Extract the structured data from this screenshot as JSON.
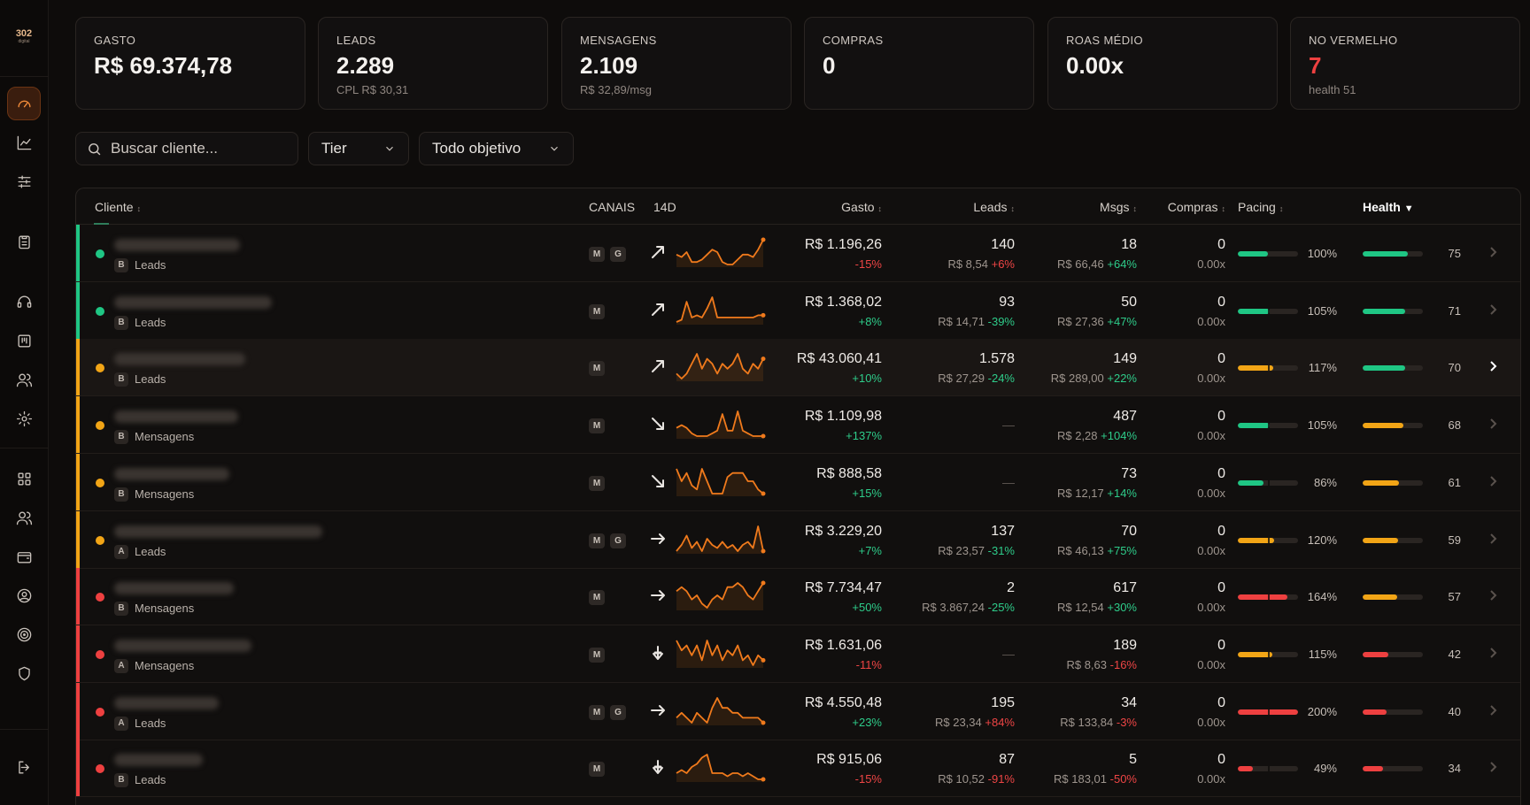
{
  "logo": {
    "text": "302",
    "sub": "digital"
  },
  "cards": [
    {
      "label": "GASTO",
      "value": "R$ 69.374,78",
      "sub": ""
    },
    {
      "label": "LEADS",
      "value": "2.289",
      "sub": "CPL R$ 30,31"
    },
    {
      "label": "MENSAGENS",
      "value": "2.109",
      "sub": "R$ 32,89/msg"
    },
    {
      "label": "COMPRAS",
      "value": "0",
      "sub": ""
    },
    {
      "label": "ROAS MÉDIO",
      "value": "0.00x",
      "sub": ""
    },
    {
      "label": "NO VERMELHO",
      "value": "7",
      "sub": "health 51"
    }
  ],
  "filters": {
    "search_placeholder": "Buscar cliente...",
    "tier": "Tier",
    "objective": "Todo objetivo"
  },
  "headers": {
    "cliente": "Cliente",
    "canais": "CANAIS",
    "d14": "14D",
    "gasto": "Gasto",
    "leads": "Leads",
    "msgs": "Msgs",
    "compras": "Compras",
    "pacing": "Pacing",
    "health": "Health"
  },
  "colors": {
    "green": "#1fc684",
    "yellow": "#f2a516",
    "red": "#ee4040",
    "spark": "#f07a1c"
  },
  "rows": [
    {
      "status": "green",
      "tier": "B",
      "objective": "Leads",
      "channels": [
        "M",
        "G"
      ],
      "trend": "up",
      "gasto": "R$ 1.196,26",
      "gasto_delta": "-15%",
      "gasto_dir": "neg",
      "leads": "140",
      "leads_cpl": "R$ 8,54",
      "leads_delta": "+6%",
      "leads_dir": "neg",
      "msgs": "18",
      "msgs_cost": "R$ 66,46",
      "msgs_delta": "+64%",
      "msgs_dir": "pos",
      "compras": "0",
      "roas": "0.00x",
      "pacing": "100%",
      "pacing_val": 100,
      "pacing_color": "green",
      "health": "75",
      "health_val": 75,
      "health_color": "green",
      "spark": [
        6,
        5,
        7,
        3,
        3,
        4,
        6,
        8,
        7,
        3,
        2,
        2,
        4,
        6,
        6,
        5,
        8,
        12
      ]
    },
    {
      "status": "green",
      "tier": "B",
      "objective": "Leads",
      "channels": [
        "M"
      ],
      "trend": "up",
      "gasto": "R$ 1.368,02",
      "gasto_delta": "+8%",
      "gasto_dir": "pos",
      "leads": "93",
      "leads_cpl": "R$ 14,71",
      "leads_delta": "-39%",
      "leads_dir": "pos",
      "msgs": "50",
      "msgs_cost": "R$ 27,36",
      "msgs_delta": "+47%",
      "msgs_dir": "pos",
      "compras": "0",
      "roas": "0.00x",
      "pacing": "105%",
      "pacing_val": 105,
      "pacing_color": "green",
      "health": "71",
      "health_val": 71,
      "health_color": "green",
      "spark": [
        2,
        3,
        11,
        4,
        5,
        4,
        8,
        13,
        4,
        4,
        4,
        4,
        4,
        4,
        4,
        4,
        5,
        5
      ]
    },
    {
      "status": "yellow",
      "tier": "B",
      "objective": "Leads",
      "channels": [
        "M"
      ],
      "trend": "up",
      "gasto": "R$ 43.060,41",
      "gasto_delta": "+10%",
      "gasto_dir": "pos",
      "leads": "1.578",
      "leads_cpl": "R$ 27,29",
      "leads_delta": "-24%",
      "leads_dir": "pos",
      "msgs": "149",
      "msgs_cost": "R$ 289,00",
      "msgs_delta": "+22%",
      "msgs_dir": "pos",
      "compras": "0",
      "roas": "0.00x",
      "pacing": "117%",
      "pacing_val": 117,
      "pacing_color": "yellow",
      "health": "70",
      "health_val": 70,
      "health_color": "green",
      "spark": [
        5,
        4,
        5,
        7,
        9,
        6,
        8,
        7,
        5,
        7,
        6,
        7,
        9,
        6,
        5,
        7,
        6,
        8
      ]
    },
    {
      "status": "yellow",
      "tier": "B",
      "objective": "Mensagens",
      "channels": [
        "M"
      ],
      "trend": "down",
      "gasto": "R$ 1.109,98",
      "gasto_delta": "+137%",
      "gasto_dir": "pos",
      "leads": "",
      "leads_cpl": "",
      "leads_delta": "",
      "leads_dir": "pos",
      "msgs": "487",
      "msgs_cost": "R$ 2,28",
      "msgs_delta": "+104%",
      "msgs_dir": "pos",
      "compras": "0",
      "roas": "0.00x",
      "pacing": "105%",
      "pacing_val": 105,
      "pacing_color": "green",
      "health": "68",
      "health_val": 68,
      "health_color": "yellow",
      "spark": [
        5,
        6,
        5,
        3,
        2,
        2,
        2,
        3,
        4,
        10,
        4,
        4,
        11,
        4,
        3,
        2,
        2,
        2
      ]
    },
    {
      "status": "yellow",
      "tier": "B",
      "objective": "Mensagens",
      "channels": [
        "M"
      ],
      "trend": "down",
      "gasto": "R$ 888,58",
      "gasto_delta": "+15%",
      "gasto_dir": "pos",
      "leads": "",
      "leads_cpl": "",
      "leads_delta": "",
      "leads_dir": "pos",
      "msgs": "73",
      "msgs_cost": "R$ 12,17",
      "msgs_delta": "+14%",
      "msgs_dir": "pos",
      "compras": "0",
      "roas": "0.00x",
      "pacing": "86%",
      "pacing_val": 86,
      "pacing_color": "green",
      "health": "61",
      "health_val": 61,
      "health_color": "yellow",
      "spark": [
        8,
        5,
        7,
        4,
        3,
        8,
        5,
        2,
        2,
        2,
        6,
        7,
        7,
        7,
        5,
        5,
        3,
        2
      ]
    },
    {
      "status": "yellow",
      "tier": "A",
      "objective": "Leads",
      "channels": [
        "M",
        "G"
      ],
      "trend": "flat",
      "gasto": "R$ 3.229,20",
      "gasto_delta": "+7%",
      "gasto_dir": "pos",
      "leads": "137",
      "leads_cpl": "R$ 23,57",
      "leads_delta": "-31%",
      "leads_dir": "pos",
      "msgs": "70",
      "msgs_cost": "R$ 46,13",
      "msgs_delta": "+75%",
      "msgs_dir": "pos",
      "compras": "0",
      "roas": "0.00x",
      "pacing": "120%",
      "pacing_val": 120,
      "pacing_color": "yellow",
      "health": "59",
      "health_val": 59,
      "health_color": "yellow",
      "spark": [
        3,
        5,
        8,
        4,
        6,
        3,
        7,
        5,
        4,
        6,
        4,
        5,
        3,
        5,
        6,
        4,
        11,
        3
      ]
    },
    {
      "status": "red",
      "tier": "B",
      "objective": "Mensagens",
      "channels": [
        "M"
      ],
      "trend": "flat",
      "gasto": "R$ 7.734,47",
      "gasto_delta": "+50%",
      "gasto_dir": "pos",
      "leads": "2",
      "leads_cpl": "R$ 3.867,24",
      "leads_delta": "-25%",
      "leads_dir": "pos",
      "msgs": "617",
      "msgs_cost": "R$ 12,54",
      "msgs_delta": "+30%",
      "msgs_dir": "pos",
      "compras": "0",
      "roas": "0.00x",
      "pacing": "164%",
      "pacing_val": 164,
      "pacing_color": "red",
      "health": "57",
      "health_val": 57,
      "health_color": "yellow",
      "spark": [
        7,
        8,
        7,
        5,
        6,
        4,
        3,
        5,
        6,
        5,
        8,
        8,
        9,
        8,
        6,
        5,
        7,
        9
      ]
    },
    {
      "status": "red",
      "tier": "A",
      "objective": "Mensagens",
      "channels": [
        "M"
      ],
      "trend": "plunge",
      "gasto": "R$ 1.631,06",
      "gasto_delta": "-11%",
      "gasto_dir": "neg",
      "leads": "",
      "leads_cpl": "",
      "leads_delta": "",
      "leads_dir": "pos",
      "msgs": "189",
      "msgs_cost": "R$ 8,63",
      "msgs_delta": "-16%",
      "msgs_dir": "neg",
      "compras": "0",
      "roas": "0.00x",
      "pacing": "115%",
      "pacing_val": 115,
      "pacing_color": "yellow",
      "health": "42",
      "health_val": 42,
      "health_color": "red",
      "spark": [
        9,
        7,
        8,
        6,
        8,
        5,
        9,
        6,
        8,
        5,
        7,
        6,
        8,
        5,
        6,
        4,
        6,
        5
      ]
    },
    {
      "status": "red",
      "tier": "A",
      "objective": "Leads",
      "channels": [
        "M",
        "G"
      ],
      "trend": "flat",
      "gasto": "R$ 4.550,48",
      "gasto_delta": "+23%",
      "gasto_dir": "pos",
      "leads": "195",
      "leads_cpl": "R$ 23,34",
      "leads_delta": "+84%",
      "leads_dir": "neg",
      "msgs": "34",
      "msgs_cost": "R$ 133,84",
      "msgs_delta": "-3%",
      "msgs_dir": "neg",
      "compras": "0",
      "roas": "0.00x",
      "pacing": "200%",
      "pacing_val": 200,
      "pacing_color": "red",
      "health": "40",
      "health_val": 40,
      "health_color": "red",
      "spark": [
        5,
        6,
        5,
        4,
        6,
        5,
        4,
        7,
        9,
        7,
        7,
        6,
        6,
        5,
        5,
        5,
        5,
        4
      ]
    },
    {
      "status": "red",
      "tier": "B",
      "objective": "Leads",
      "channels": [
        "M"
      ],
      "trend": "plunge",
      "gasto": "R$ 915,06",
      "gasto_delta": "-15%",
      "gasto_dir": "neg",
      "leads": "87",
      "leads_cpl": "R$ 10,52",
      "leads_delta": "-91%",
      "leads_dir": "neg",
      "msgs": "5",
      "msgs_cost": "R$ 183,01",
      "msgs_delta": "-50%",
      "msgs_dir": "neg",
      "compras": "0",
      "roas": "0.00x",
      "pacing": "49%",
      "pacing_val": 49,
      "pacing_color": "red",
      "health": "34",
      "health_val": 34,
      "health_color": "red",
      "spark": [
        4,
        5,
        4,
        6,
        7,
        9,
        10,
        4,
        4,
        4,
        3,
        4,
        4,
        3,
        4,
        3,
        2,
        2
      ]
    }
  ]
}
